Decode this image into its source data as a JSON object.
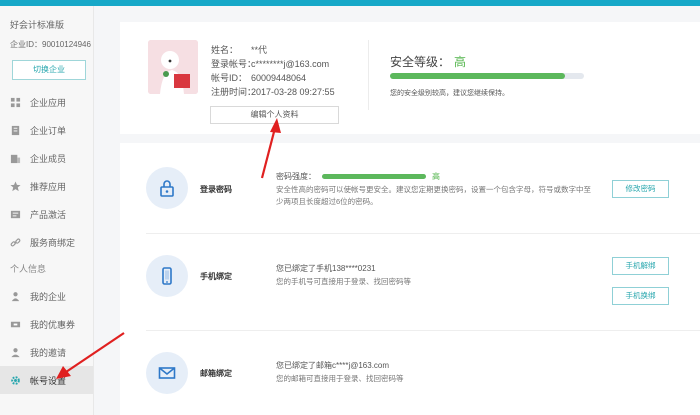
{
  "sidebar": {
    "edition": "好会计标准版",
    "enterprise_id": "企业ID：90010124946",
    "switch_label": "切换企业",
    "items": [
      {
        "label": "企业应用",
        "icon": "grid-icon"
      },
      {
        "label": "企业订单",
        "icon": "order-icon"
      },
      {
        "label": "企业成员",
        "icon": "members-icon"
      },
      {
        "label": "推荐应用",
        "icon": "star-icon"
      },
      {
        "label": "产品激活",
        "icon": "activation-icon"
      },
      {
        "label": "服务商绑定",
        "icon": "link-icon"
      }
    ],
    "group_label": "个人信息",
    "personal_items": [
      {
        "label": "我的企业",
        "icon": "person-icon"
      },
      {
        "label": "我的优惠券",
        "icon": "coupon-icon"
      },
      {
        "label": "我的邀请",
        "icon": "invite-icon"
      },
      {
        "label": "帐号设置",
        "icon": "gear-icon",
        "active": true
      }
    ]
  },
  "profile": {
    "name_label": "姓名：",
    "name_value": "**代",
    "account_label": "登录帐号：",
    "account_value": "c********j@163.com",
    "id_label": "帐号ID：",
    "id_value": "60009448064",
    "reg_label": "注册时间：",
    "reg_value": "2017-03-28 09:27:55",
    "edit_label": "编辑个人资料"
  },
  "security": {
    "title": "安全等级：",
    "level": "高",
    "progress": 0.9,
    "note": "您的安全级别较高，建议您继续保持。"
  },
  "rows": {
    "password": {
      "title": "登录密码",
      "strength_label": "密码强度：",
      "strength_level": "高",
      "desc": "安全性高的密码可以使帐号更安全。建议您定期更换密码，设置一个包含字母，符号或数字中至少两项且长度超过6位的密码。",
      "button": "修改密码"
    },
    "phone": {
      "title": "手机绑定",
      "text": "您已绑定了手机138****0231",
      "desc": "您的手机号可直接用于登录、找回密码等",
      "button_unbind": "手机解绑",
      "button_change": "手机换绑"
    },
    "email": {
      "title": "邮箱绑定",
      "text": "您已绑定了邮箱c****j@163.com",
      "desc": "您的邮箱可直接用于登录、找回密码等"
    }
  },
  "colors": {
    "brand": "#17a8c8",
    "accent": "#26a6ad",
    "safe": "#5cb85c",
    "arrow": "#e02020"
  }
}
